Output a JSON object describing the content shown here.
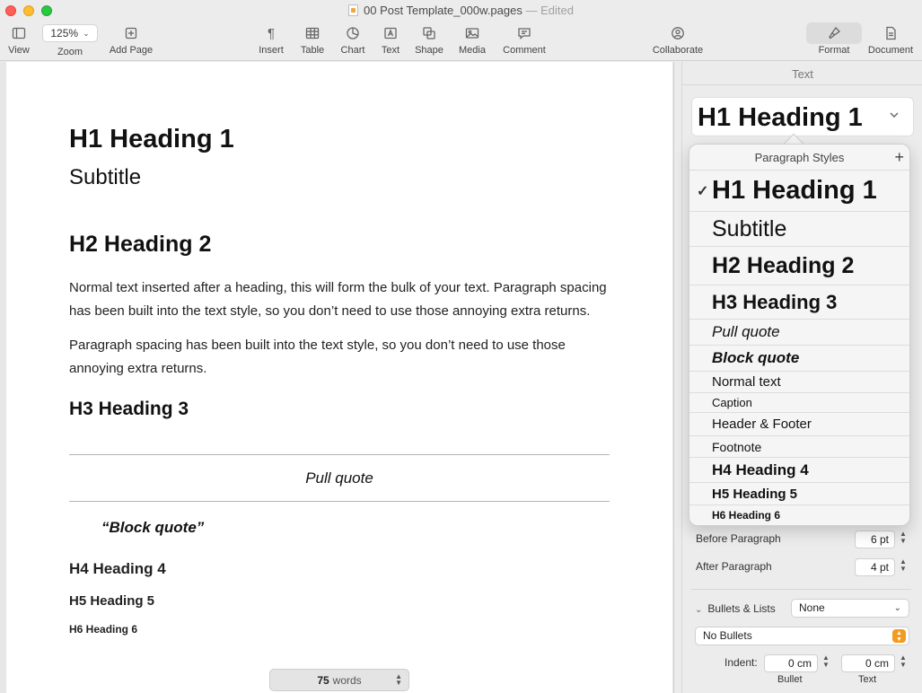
{
  "window": {
    "title": "00 Post Template_000w.pages",
    "separator": "—",
    "status": "Edited"
  },
  "toolbar": {
    "view": "View",
    "zoom_value": "125%",
    "zoom": "Zoom",
    "add_page": "Add Page",
    "insert": "Insert",
    "table": "Table",
    "chart": "Chart",
    "text": "Text",
    "shape": "Shape",
    "media": "Media",
    "comment": "Comment",
    "collaborate": "Collaborate",
    "format": "Format",
    "document": "Document"
  },
  "document": {
    "h1": "H1 Heading 1",
    "subtitle": "Subtitle",
    "h2": "H2 Heading 2",
    "para1": "Normal text inserted after a heading, this will form the bulk of your text. Paragraph spacing has been built into the text style, so you don’t need to use those annoying extra returns.",
    "para2": "Paragraph spacing has been built into the text style, so you don’t need to use those annoying extra returns.",
    "h3": "H3 Heading 3",
    "pull_quote": "Pull quote",
    "block_quote": "“Block quote”",
    "h4": "H4 Heading 4",
    "h5": "H5 Heading 5",
    "h6": "H6 Heading 6"
  },
  "word_count": {
    "count": "75",
    "label": "words"
  },
  "sidebar": {
    "header": "Text",
    "current_style": "H1 Heading 1",
    "popover_title": "Paragraph Styles",
    "styles": [
      "H1 Heading 1",
      "Subtitle",
      "H2 Heading 2",
      "H3 Heading 3",
      "Pull quote",
      "Block quote",
      "Normal text",
      "Caption",
      "Header & Footer",
      "Footnote",
      "H4 Heading 4",
      "H5 Heading 5",
      "H6 Heading 6"
    ],
    "selected_style": "H1 Heading 1",
    "before_paragraph_label": "Before Paragraph",
    "before_paragraph_value": "6 pt",
    "after_paragraph_label": "After Paragraph",
    "after_paragraph_value": "4 pt",
    "bullets_label": "Bullets & Lists",
    "bullets_value": "None",
    "bullet_type": "No Bullets",
    "indent_label": "Indent:",
    "indent_bullet_value": "0 cm",
    "indent_text_value": "0 cm",
    "bullet_col": "Bullet",
    "text_col": "Text"
  }
}
